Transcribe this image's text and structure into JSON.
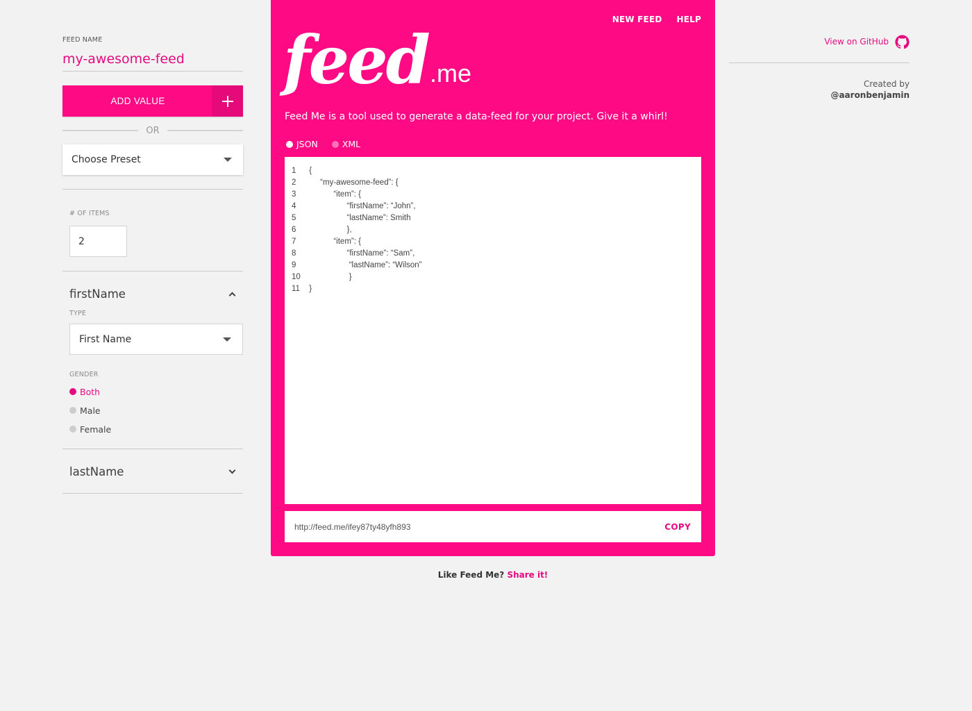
{
  "colors": {
    "accent": "#ff0a85",
    "accent_dark": "#e5097f",
    "background": "#f2f2f2"
  },
  "sidebar": {
    "feed_name_label": "FEED NAME",
    "feed_name_value": "my-awesome-feed",
    "add_value_label": "ADD VALUE",
    "or_text": "OR",
    "preset_select_value": "Choose Preset",
    "items_label": "# OF ITEMS",
    "items_value": "2",
    "fields": [
      {
        "name": "firstName",
        "expanded": true,
        "type_label": "TYPE",
        "type_value": "First Name",
        "gender_label": "GENDER",
        "gender_options": [
          {
            "label": "Both",
            "selected": true
          },
          {
            "label": "Male",
            "selected": false
          },
          {
            "label": "Female",
            "selected": false
          }
        ]
      },
      {
        "name": "lastName",
        "expanded": false
      }
    ]
  },
  "header": {
    "nav": {
      "new_feed": "NEW FEED",
      "help": "HELP"
    },
    "logo_word": "feed",
    "logo_suffix": ".me",
    "tagline": "Feed Me is a tool used to generate a data-feed for your project. Give it a whirl!"
  },
  "formats": [
    {
      "label": "JSON",
      "selected": true
    },
    {
      "label": "XML",
      "selected": false
    }
  ],
  "code_lines": [
    {
      "num": "1",
      "text": " {"
    },
    {
      "num": "2",
      "text": "      “my-awesome-feed”: {"
    },
    {
      "num": "3",
      "text": "            “item”: {"
    },
    {
      "num": "4",
      "text": "                  “firstName”: “John”,"
    },
    {
      "num": "5",
      "text": "                  “lastName”: Smith"
    },
    {
      "num": "6",
      "text": "                  },"
    },
    {
      "num": "7",
      "text": "            “item”: {"
    },
    {
      "num": "8",
      "text": "                  “firstName”: “Sam”,"
    },
    {
      "num": "9",
      "text": "                   “lastName”: “Wilson”"
    },
    {
      "num": "10",
      "text": "                   }"
    },
    {
      "num": "11",
      "text": " }"
    }
  ],
  "url_bar": {
    "url": "http://feed.me/ifey87ty48yfh893",
    "copy_label": "COPY"
  },
  "footer": {
    "share_prefix": "Like Feed Me?",
    "share_link": "Share it!"
  },
  "right": {
    "github_link": "View on GitHub",
    "github_icon": "github-icon",
    "created_by": "Created by",
    "author": "@aaronbenjamin"
  }
}
